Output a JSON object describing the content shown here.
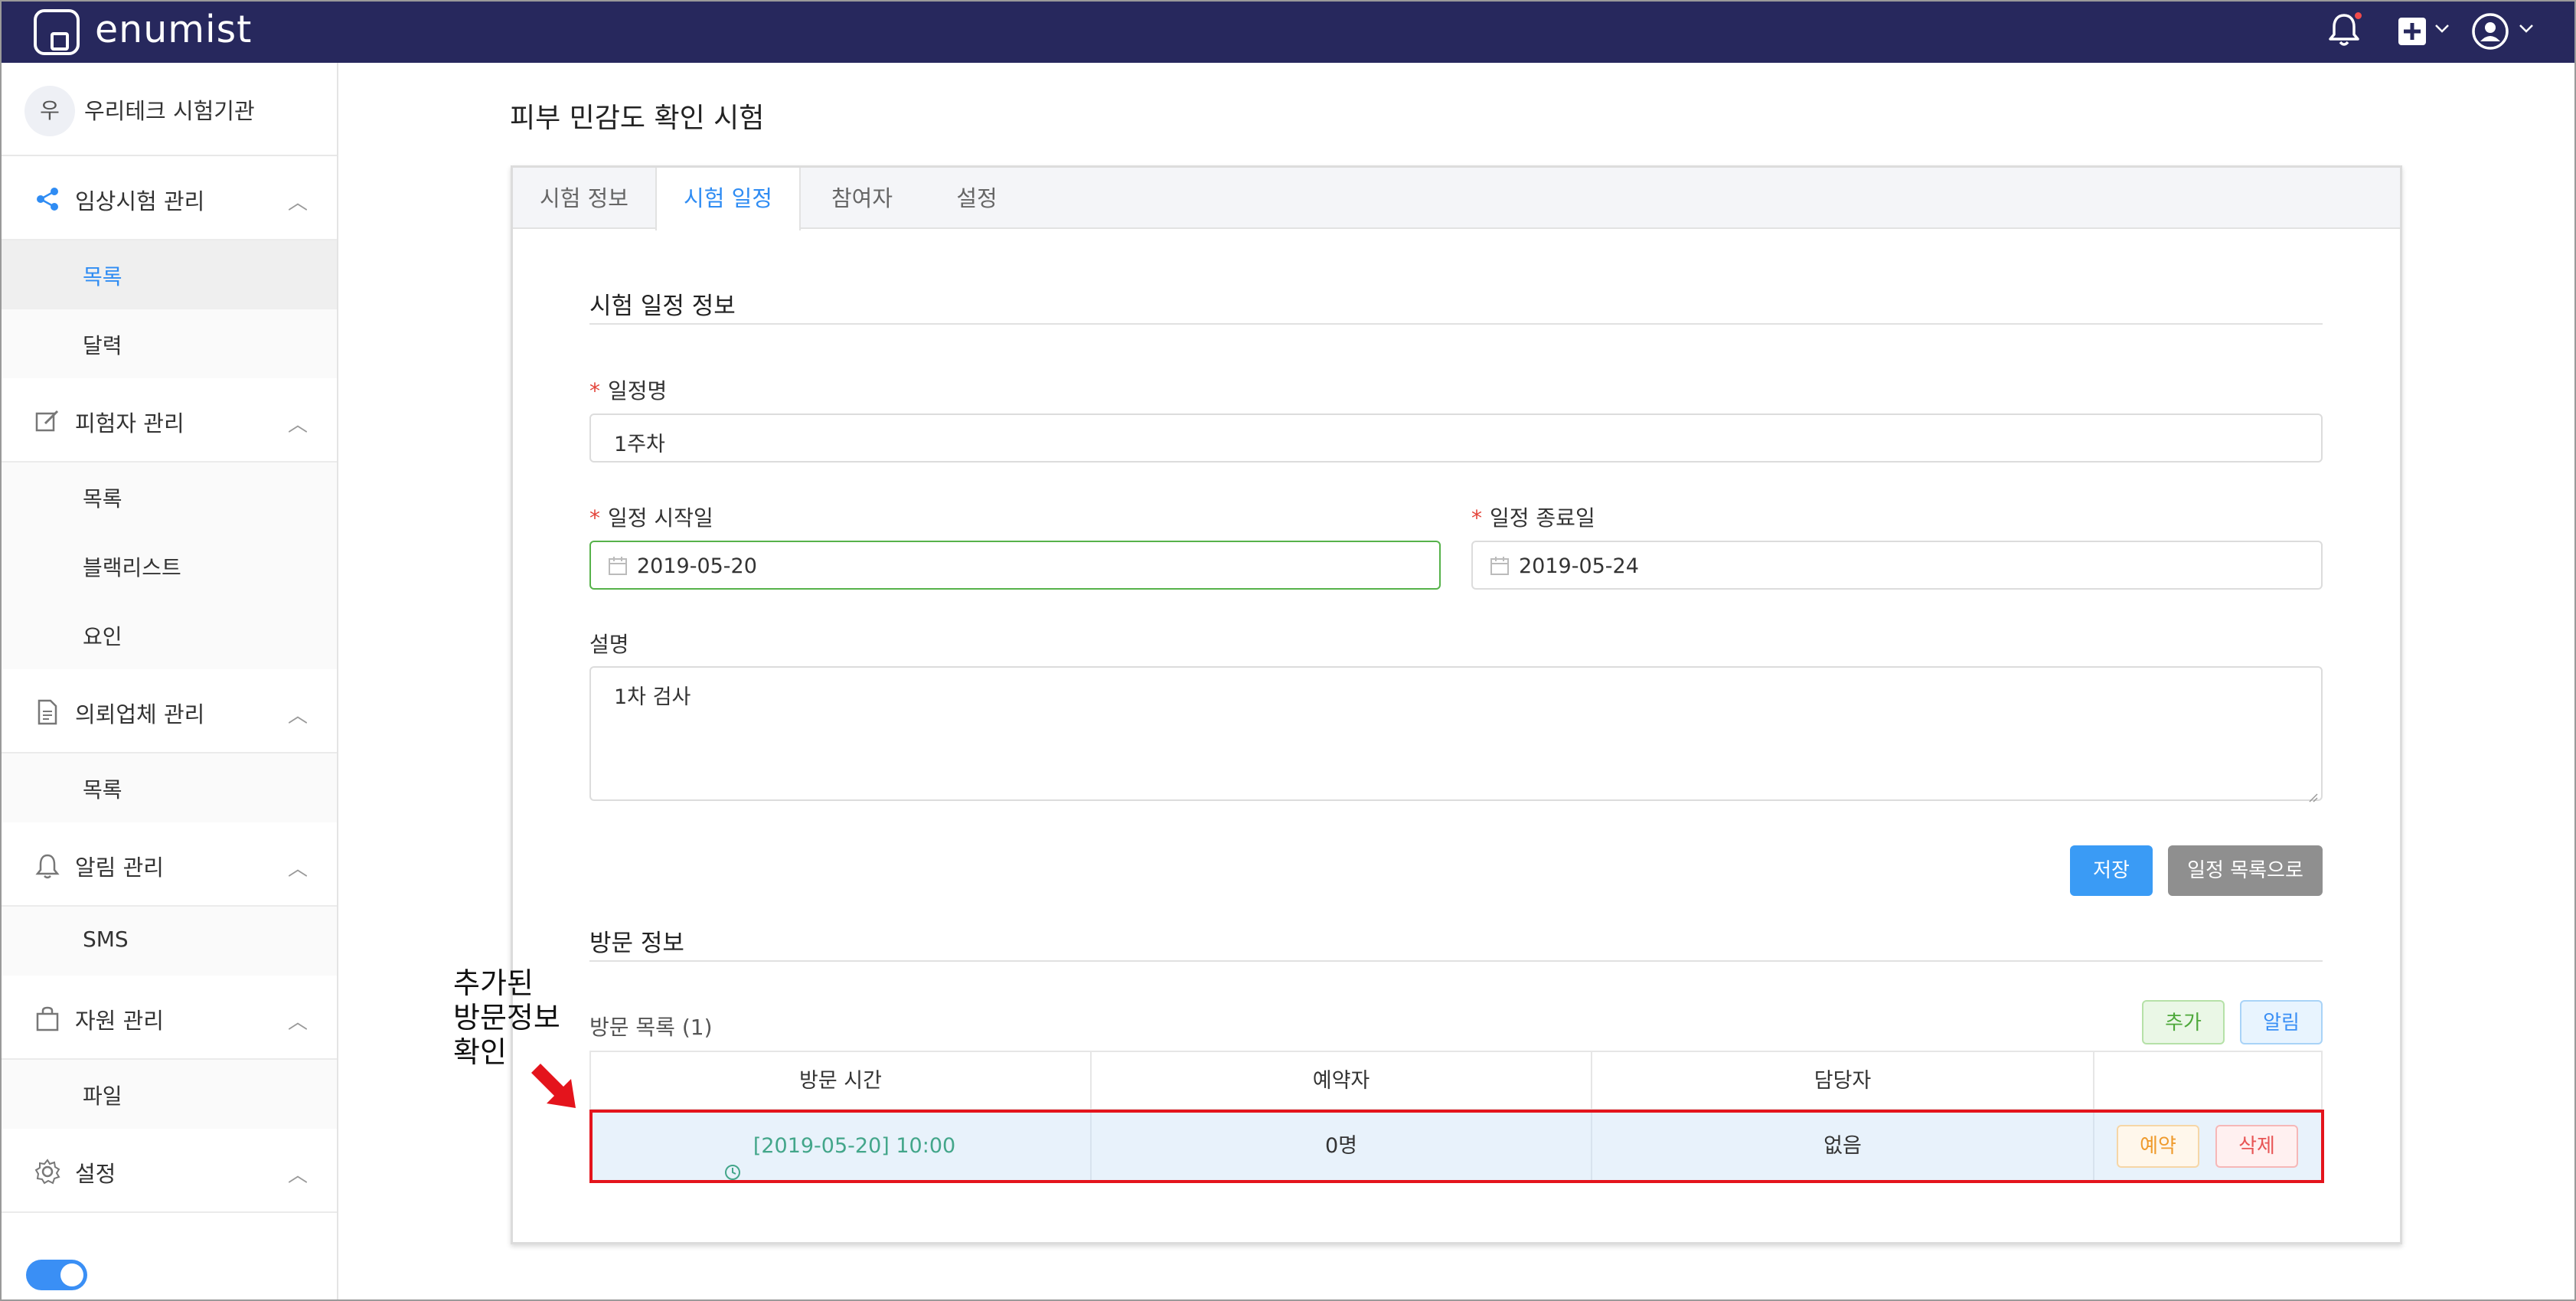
{
  "app": {
    "brand": "enumist"
  },
  "sidebar": {
    "org": {
      "avatar_char": "우",
      "name": "우리테크 시험기관"
    },
    "sections": [
      {
        "label": "임상시험 관리",
        "items": [
          "목록",
          "달력"
        ]
      },
      {
        "label": "피험자 관리",
        "items": [
          "목록",
          "블랙리스트",
          "요인"
        ]
      },
      {
        "label": "의뢰업체 관리",
        "items": [
          "목록"
        ]
      },
      {
        "label": "알림 관리",
        "items": [
          "SMS"
        ]
      },
      {
        "label": "자원 관리",
        "items": [
          "파일"
        ]
      },
      {
        "label": "설정",
        "items": []
      }
    ]
  },
  "page": {
    "title": "피부 민감도 확인 시험",
    "tabs": [
      "시험 정보",
      "시험 일정",
      "참여자",
      "설정"
    ],
    "active_tab": "시험 일정"
  },
  "schedule": {
    "heading": "시험 일정 정보",
    "name_label": "일정명",
    "name_value": "1주차",
    "start_label": "일정 시작일",
    "start_value": "2019-05-20",
    "end_label": "일정 종료일",
    "end_value": "2019-05-24",
    "desc_label": "설명",
    "desc_value": "1차 검사",
    "save_button": "저장",
    "list_button": "일정 목록으로"
  },
  "visits": {
    "heading": "방문 정보",
    "list_title": "방문 목록 (1)",
    "add_button": "추가",
    "notify_button": "알림",
    "columns": [
      "방문 시간",
      "예약자",
      "담당자",
      ""
    ],
    "rows": [
      {
        "time": "[2019-05-20] 10:00",
        "reserved": "0명",
        "manager": "없음",
        "reserve_button": "예약",
        "delete_button": "삭제"
      }
    ]
  },
  "annotation": {
    "line1": "추가된",
    "line2": "방문정보",
    "line3": "확인"
  },
  "colors": {
    "topbar": "#27285d",
    "accent": "#2f8cf3",
    "highlight": "#e4141c"
  }
}
